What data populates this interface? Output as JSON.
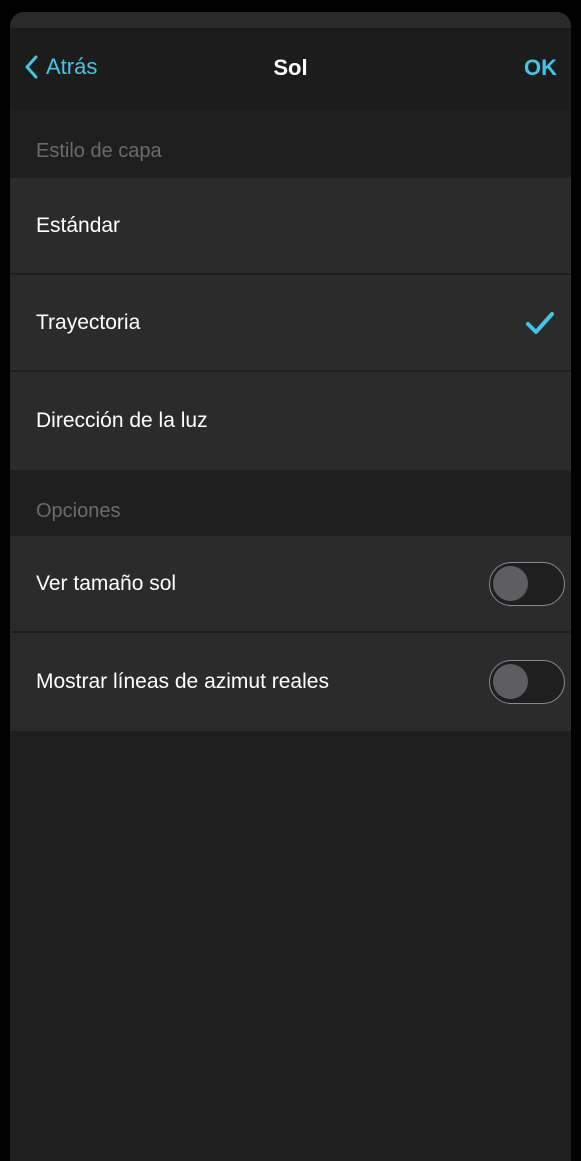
{
  "nav": {
    "back_label": "Atrás",
    "title": "Sol",
    "ok_label": "OK"
  },
  "sections": {
    "layer_style": {
      "header": "Estilo de capa",
      "options": [
        {
          "label": "Estándar",
          "selected": false
        },
        {
          "label": "Trayectoria",
          "selected": true
        },
        {
          "label": "Dirección de la luz",
          "selected": false
        }
      ]
    },
    "options": {
      "header": "Opciones",
      "toggles": [
        {
          "label": "Ver tamaño sol",
          "on": false
        },
        {
          "label": "Mostrar líneas de azimut reales",
          "on": false
        }
      ]
    }
  },
  "colors": {
    "accent": "#45c4e6",
    "background": "#1f1f20",
    "row_background": "#2b2b2c",
    "section_text": "#6b6b6e"
  },
  "icons": {
    "back": "chevron-left-icon",
    "selected": "checkmark-icon"
  }
}
